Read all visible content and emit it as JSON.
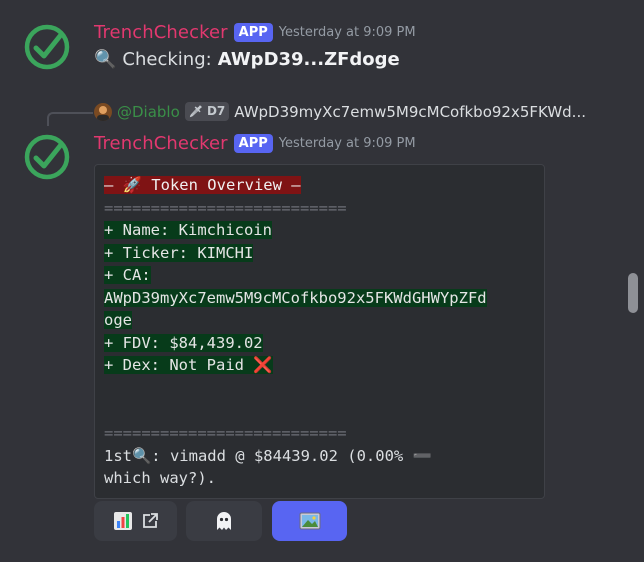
{
  "message1": {
    "username": "TrenchChecker",
    "badge": "APP",
    "timestamp": "Yesterday at 9:09 PM",
    "checking_prefix": "Checking:",
    "checking_value": "AWpD39...ZFdoge"
  },
  "reply": {
    "username": "@Diablo",
    "tag": "D7",
    "text": "AWpD39myXc7emw5M9cMCofkbo92x5FKWd..."
  },
  "message2": {
    "username": "TrenchChecker",
    "badge": "APP",
    "timestamp": "Yesterday at 9:09 PM"
  },
  "embed": {
    "title": "– 🚀 Token Overview –",
    "separator": "==========================",
    "lines": [
      "+ Name: Kimchicoin",
      "+ Ticker: KIMCHI",
      "+ CA:",
      "AWpD39myXc7emw5M9cMCofkbo92x5FKWdGHWYpZFd",
      "oge",
      "+ FDV: $84,439.02",
      "+ Dex: Not Paid ❌"
    ],
    "footer_line1": "1st🔍: vimadd @ $84439.02 (0.00% ➖",
    "footer_line2": "which way?)."
  },
  "buttons": [
    {
      "icon": "chart-icon",
      "extra_icon": "external-link-icon"
    },
    {
      "icon": "ghost-icon"
    },
    {
      "icon": "image-icon"
    }
  ],
  "colors": {
    "background": "#323339",
    "username": "#e2386f",
    "app_badge": "#5865f2",
    "check_green": "#3ba55c",
    "highlight_red": "#7f1314",
    "highlight_green": "#073b1a",
    "primary_button": "#5865f2"
  }
}
